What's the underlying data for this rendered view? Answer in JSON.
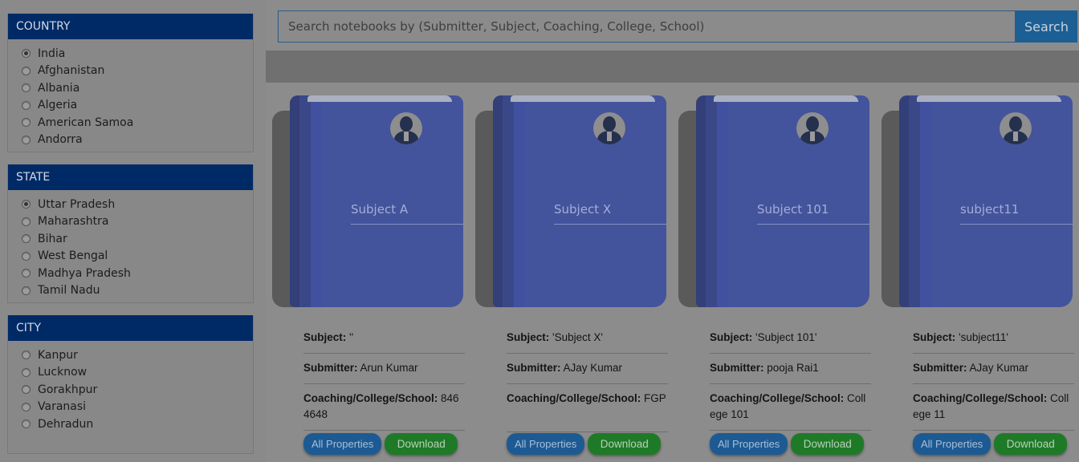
{
  "filters": [
    {
      "title": "COUNTRY",
      "options": [
        "India",
        "Afghanistan",
        "Albania",
        "Algeria",
        "American Samoa",
        "Andorra"
      ],
      "selected": "India"
    },
    {
      "title": "STATE",
      "options": [
        "Uttar Pradesh",
        "Maharashtra",
        "Bihar",
        "West Bengal",
        "Madhya Pradesh",
        "Tamil Nadu"
      ],
      "selected": "Uttar Pradesh"
    },
    {
      "title": "CITY",
      "options": [
        "Kanpur",
        "Lucknow",
        "Gorakhpur",
        "Varanasi",
        "Dehradun"
      ],
      "selected": ""
    }
  ],
  "search": {
    "placeholder": "Search notebooks by (Submitter, Subject, Coaching, College, School)",
    "button_label": "Search"
  },
  "notebooks": [
    {
      "cover_title": "Subject A",
      "subject_label": "Subject:",
      "subject": "''",
      "submitter_label": "Submitter:",
      "submitter": "Arun Kumar",
      "school_label": "Coaching/College/School:",
      "school": "8464648",
      "props_label": "All Properties",
      "download_label": "Download"
    },
    {
      "cover_title": "Subject X",
      "subject_label": "Subject:",
      "subject": "'Subject X'",
      "submitter_label": "Submitter:",
      "submitter": "AJay Kumar",
      "school_label": "Coaching/College/School:",
      "school": "FGP",
      "props_label": "All Properties",
      "download_label": "Download"
    },
    {
      "cover_title": "Subject 101",
      "subject_label": "Subject:",
      "subject": "'Subject 101'",
      "submitter_label": "Submitter:",
      "submitter": "pooja Rai1",
      "school_label": "Coaching/College/School:",
      "school": "College 101",
      "props_label": "All Properties",
      "download_label": "Download"
    },
    {
      "cover_title": "subject11",
      "subject_label": "Subject:",
      "subject": "'subject11'",
      "submitter_label": "Submitter:",
      "submitter": "AJay Kumar",
      "school_label": "Coaching/College/School:",
      "school": "College 11",
      "props_label": "All Properties",
      "download_label": "Download"
    }
  ],
  "colors": {
    "filter_header": "#002a66",
    "search_button": "#1c5f94",
    "props_button": "#1d5a93",
    "download_button": "#1f7a28",
    "book_cover": "#43539c"
  }
}
